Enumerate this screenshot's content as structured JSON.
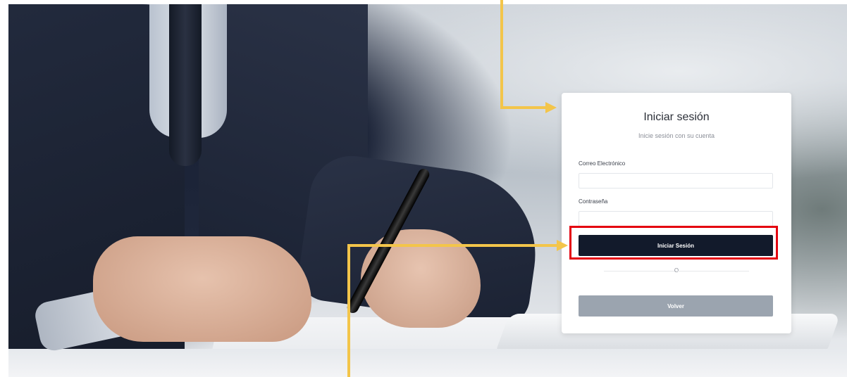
{
  "login": {
    "title": "Iniciar sesión",
    "subtitle": "Inicie sesión con su cuenta",
    "email_label": "Correo Electrónico",
    "email_value": "",
    "password_label": "Contraseña",
    "password_value": "",
    "submit_label": "Iniciar Sesión",
    "divider_text": "O",
    "back_label": "Volver"
  },
  "colors": {
    "primary_button": "#121a2b",
    "secondary_button": "#9ba4af",
    "highlight": "#e4010f",
    "arrow": "#f3c54a"
  },
  "icons": {
    "top_arrow": "arrow-right-icon",
    "bottom_arrow": "arrow-right-icon"
  }
}
